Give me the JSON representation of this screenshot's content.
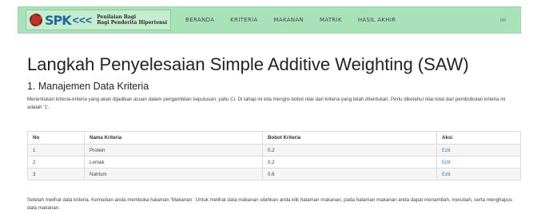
{
  "nav": {
    "logo_text": "SPK",
    "logo_chevrons": "<<<",
    "logo_sub_1": "Penilaian Bagi",
    "logo_sub_2": "Bagi Penderita Hipertensi",
    "items": [
      "BERANDA",
      "KRITERIA",
      "MAKANAN",
      "MATRIK",
      "HASIL AKHIR"
    ],
    "right_label": "ini"
  },
  "page": {
    "title": "Langkah Penyelesaian Simple Additive Weighting (SAW)",
    "section_title": "1. Manajemen Data Kriteria",
    "description": "Menentukan kriteria-kriteria yang akan dijadikan acuan dalam pengambilan keputusan, yaitu Ci. Di tahap ini kita mengisi bobot nilai dari kriteria yang telah ditentukan. Perlu diketahui nilai total dari pembobotan kriteria ini adalah '1'.",
    "after_text": "Setelah melihat data kriteria. Kemudian anda membuka halaman 'Makanan'. Untuk melihat data makanan silahkan anda klik halaman makanan, pada halaman makanan anda dapat menambah, merubah, serta menghapus data makanan."
  },
  "table": {
    "headers": [
      "No",
      "Nama Kriteria",
      "Bobot Kriteria",
      "Aksi"
    ],
    "rows": [
      {
        "no": "1",
        "nama": "Protein",
        "bobot": "0.2",
        "aksi": "Edit"
      },
      {
        "no": "2",
        "nama": "Lemak",
        "bobot": "0.2",
        "aksi": "Edit"
      },
      {
        "no": "3",
        "nama": "Natrium",
        "bobot": "0.6",
        "aksi": "Edit"
      }
    ]
  },
  "colors": {
    "navbar": "#a9e2b9",
    "link": "#3b7fc4"
  }
}
